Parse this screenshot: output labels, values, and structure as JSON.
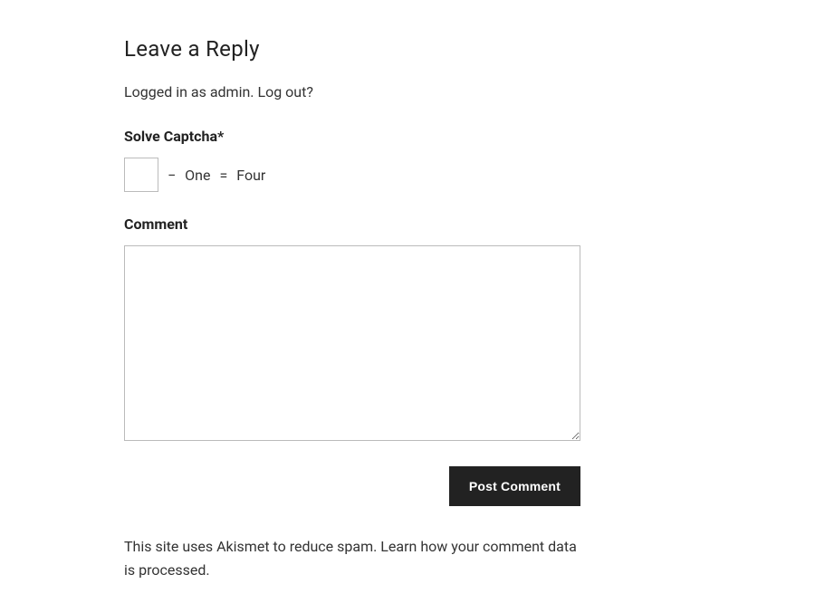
{
  "reply": {
    "title": "Leave a Reply",
    "login_status_prefix": "Logged in as ",
    "login_user": "admin",
    "login_status_suffix": ". ",
    "logout_link": "Log out?",
    "captcha": {
      "label": "Solve Captcha*",
      "input_value": "",
      "minus": "−",
      "operand1": "One",
      "equals": "=",
      "operand2": "Four"
    },
    "comment": {
      "label": "Comment",
      "value": ""
    },
    "submit_label": "Post Comment",
    "akismet": {
      "prefix": "This site uses Akismet to reduce spam. ",
      "link_text": "Learn how your comment data is processed",
      "suffix": "."
    }
  }
}
